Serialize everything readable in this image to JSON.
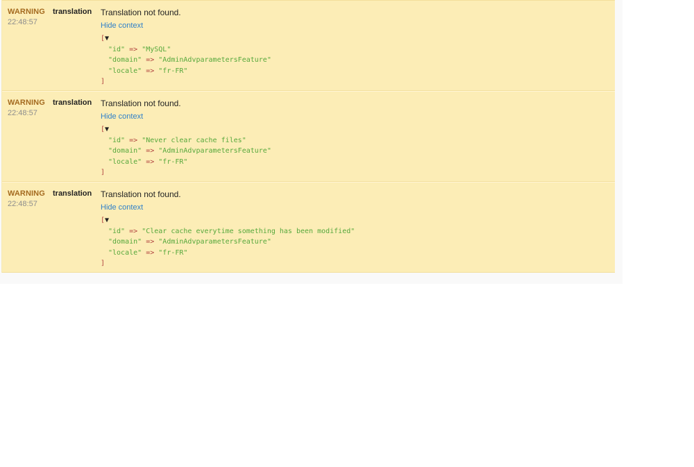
{
  "entries": [
    {
      "level": "WARNING",
      "time": "22:48:57",
      "channel": "translation",
      "message": "Translation not found.",
      "context_link": "Hide context",
      "context": [
        {
          "key": "\"id\"",
          "arrow": "=>",
          "value": "\"MySQL\""
        },
        {
          "key": "\"domain\"",
          "arrow": "=>",
          "value": "\"AdminAdvparametersFeature\""
        },
        {
          "key": "\"locale\"",
          "arrow": "=>",
          "value": "\"fr-FR\""
        }
      ]
    },
    {
      "level": "WARNING",
      "time": "22:48:57",
      "channel": "translation",
      "message": "Translation not found.",
      "context_link": "Hide context",
      "context": [
        {
          "key": "\"id\"",
          "arrow": "=>",
          "value": "\"Never clear cache files\""
        },
        {
          "key": "\"domain\"",
          "arrow": "=>",
          "value": "\"AdminAdvparametersFeature\""
        },
        {
          "key": "\"locale\"",
          "arrow": "=>",
          "value": "\"fr-FR\""
        }
      ]
    },
    {
      "level": "WARNING",
      "time": "22:48:57",
      "channel": "translation",
      "message": "Translation not found.",
      "context_link": "Hide context",
      "context": [
        {
          "key": "\"id\"",
          "arrow": "=>",
          "value": "\"Clear cache everytime something has been modified\""
        },
        {
          "key": "\"domain\"",
          "arrow": "=>",
          "value": "\"AdminAdvparametersFeature\""
        },
        {
          "key": "\"locale\"",
          "arrow": "=>",
          "value": "\"fr-FR\""
        }
      ]
    }
  ],
  "dump": {
    "open_bracket": "[",
    "toggle_glyph": "▼",
    "close_bracket": "]"
  },
  "colors": {
    "row_background": "#fcedb6",
    "level_text": "#a46a1f",
    "link": "#2f80c9",
    "dump_key": "#56a83c",
    "dump_bracket": "#b0413e"
  }
}
